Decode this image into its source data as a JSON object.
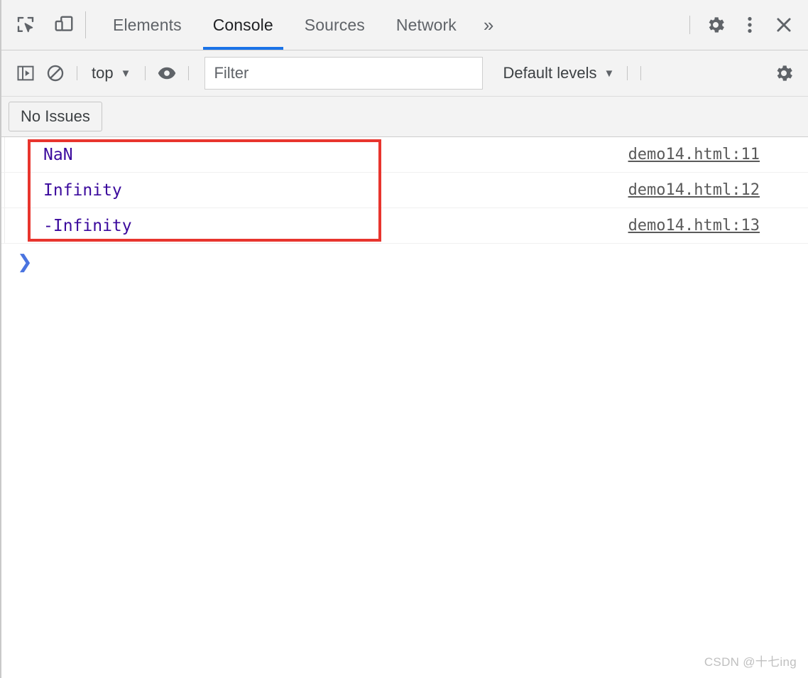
{
  "window": {
    "app": "Chrome DevTools"
  },
  "tabbar": {
    "icons": {
      "inspect": "inspect-element-icon",
      "device": "device-toolbar-icon",
      "more_tabs": "»",
      "settings": "gear-icon",
      "kebab": "kebab-menu-icon",
      "close": "close-icon"
    },
    "tabs": [
      {
        "label": "Elements",
        "active": false
      },
      {
        "label": "Console",
        "active": true
      },
      {
        "label": "Sources",
        "active": false
      },
      {
        "label": "Network",
        "active": false
      }
    ]
  },
  "console_toolbar": {
    "sidebar_toggle": "console-sidebar-toggle-icon",
    "clear_console": "clear-console-icon",
    "context": {
      "label": "top",
      "caret": "▼"
    },
    "eye": "live-expression-icon",
    "filter": {
      "placeholder": "Filter",
      "value": ""
    },
    "levels": {
      "label": "Default levels",
      "caret": "▼"
    },
    "settings": "gear-icon"
  },
  "issues_bar": {
    "button_label": "No Issues"
  },
  "console": {
    "messages": [
      {
        "text": "NaN",
        "source": "demo14.html:11"
      },
      {
        "text": "Infinity",
        "source": "demo14.html:12"
      },
      {
        "text": "-Infinity",
        "source": "demo14.html:13"
      }
    ],
    "prompt_chevron": "❯"
  },
  "annotation": {
    "color": "#e8352e"
  },
  "colors": {
    "accent": "#1a73e8",
    "value_text": "#3b0a9d",
    "link_text": "#5a5a5a",
    "toolbar_bg": "#f3f3f3",
    "annotation_red": "#e8352e"
  },
  "watermark": {
    "text": "CSDN @十七ing"
  }
}
